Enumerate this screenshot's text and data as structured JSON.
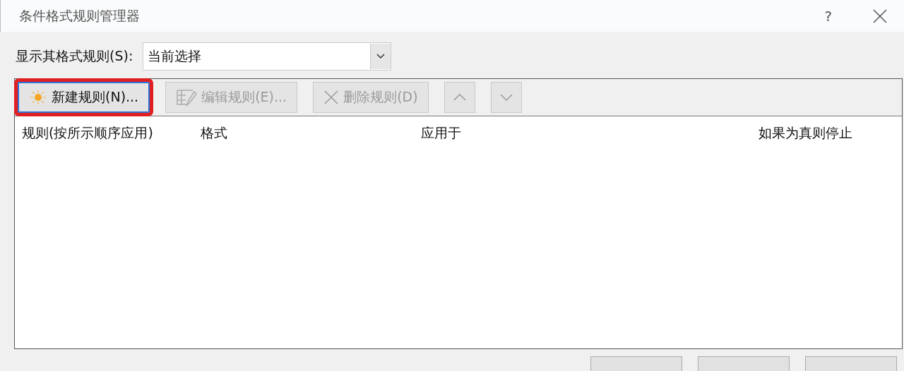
{
  "window": {
    "title": "条件格式规则管理器",
    "help": "?"
  },
  "show_rules": {
    "label": "显示其格式规则(S):",
    "value": "当前选择"
  },
  "toolbar": [
    {
      "kind": "new",
      "label": "新建规则(N)...",
      "disabled": false,
      "highlighted": true
    },
    {
      "kind": "edit",
      "label": "编辑规则(E)...",
      "disabled": true,
      "highlighted": false
    },
    {
      "kind": "delete",
      "label": "删除规则(D)",
      "disabled": true,
      "highlighted": false
    },
    {
      "kind": "up",
      "disabled": true,
      "highlighted": false
    },
    {
      "kind": "down",
      "disabled": true,
      "highlighted": false
    }
  ],
  "table": {
    "columns": [
      "规则(按所示顺序应用)",
      "格式",
      "应用于",
      "如果为真则停止"
    ]
  }
}
